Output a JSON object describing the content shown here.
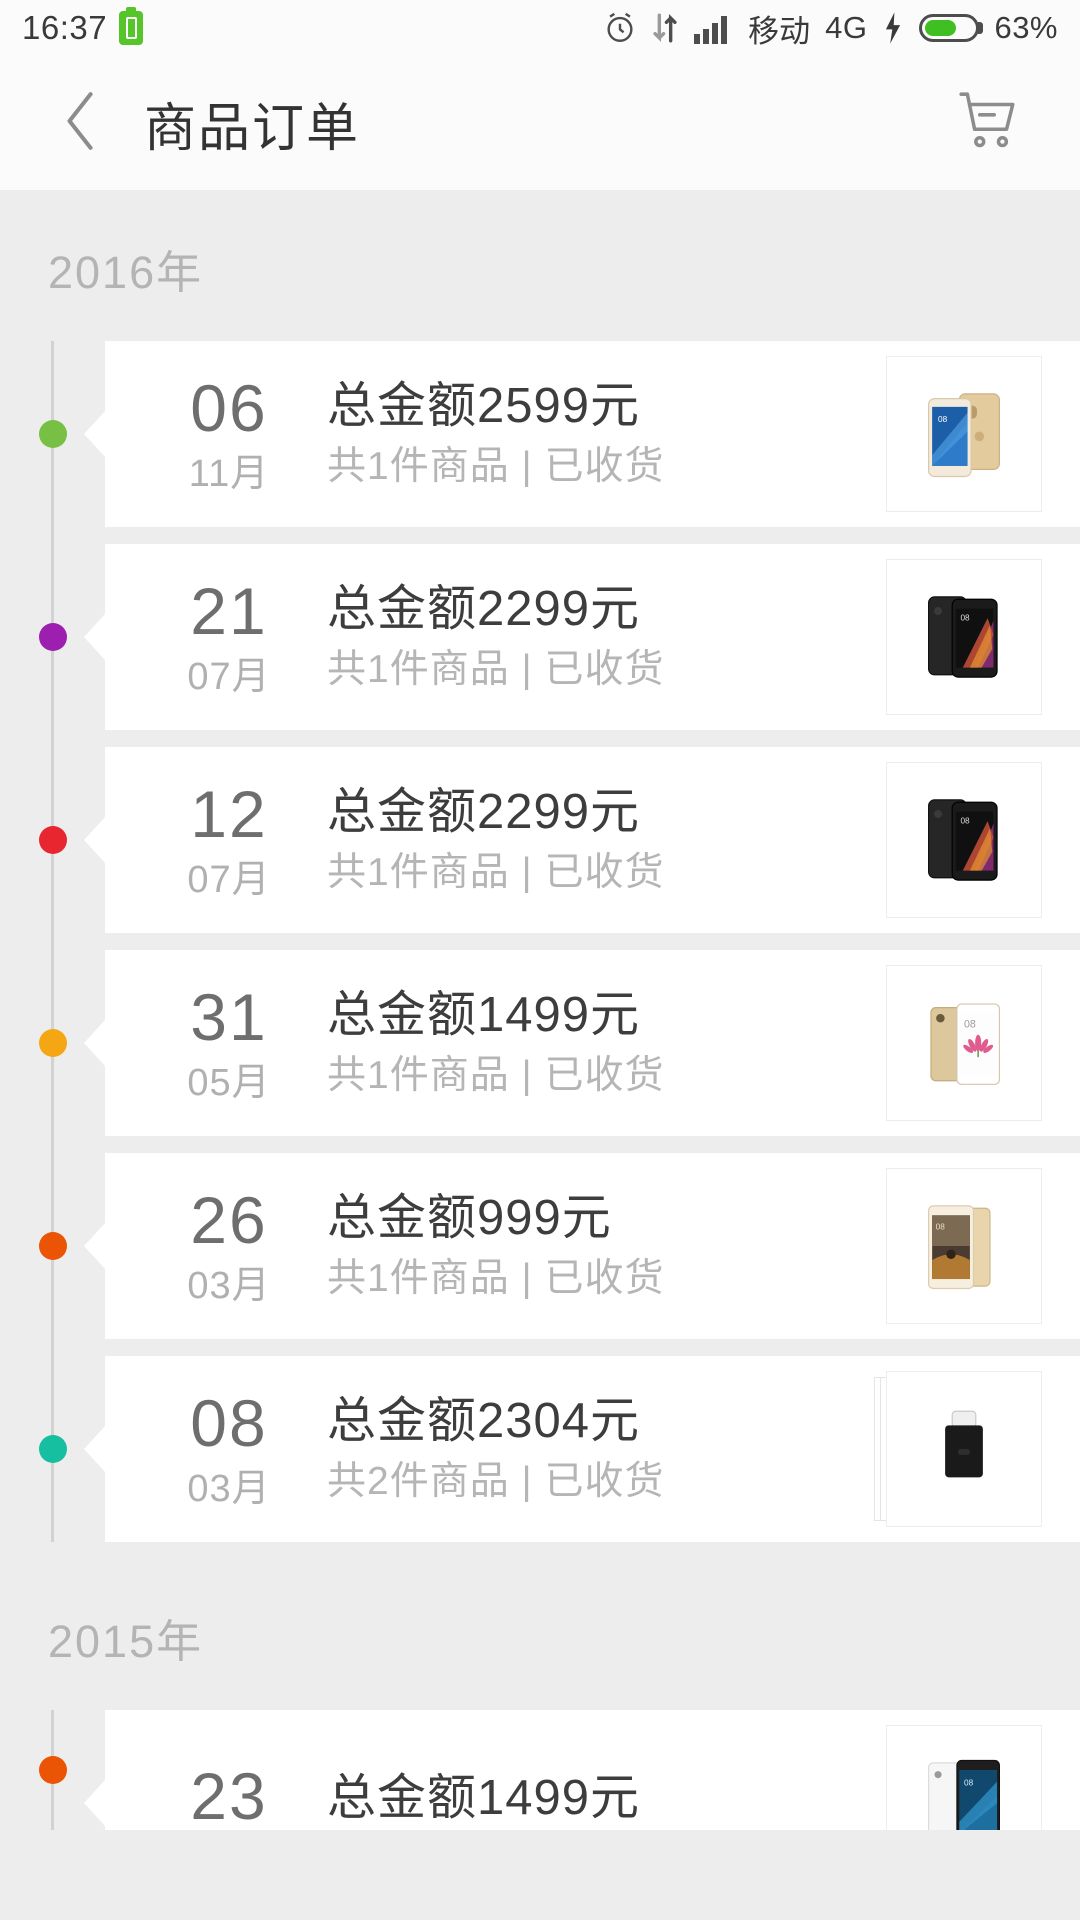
{
  "status_bar": {
    "time": "16:37",
    "battery_saver_icon": "green-battery-icon",
    "alarm_icon": "alarm-clock-icon",
    "data_icon": "data-transfer-icon",
    "signal_icon": "signal-bars-icon",
    "carrier": "移动",
    "network": "4G",
    "charging_icon": "charging-bolt-icon",
    "battery_percent": "63%",
    "battery_level": 63
  },
  "app_bar": {
    "back_icon": "back-chevron-icon",
    "title": "商品订单",
    "cart_icon": "shopping-cart-icon"
  },
  "groups": [
    {
      "year": "2016年",
      "orders": [
        {
          "day": "06",
          "month": "11月",
          "amount": "总金额2599元",
          "meta": "共1件商品 | 已收货",
          "dot_color": "#78c043",
          "thumb": "phone-gold-mi5s-icon",
          "stacked": false
        },
        {
          "day": "21",
          "month": "07月",
          "amount": "总金额2299元",
          "meta": "共1件商品 | 已收货",
          "dot_color": "#9c1fb0",
          "thumb": "phone-black-mi5-icon",
          "stacked": false
        },
        {
          "day": "12",
          "month": "07月",
          "amount": "总金额2299元",
          "meta": "共1件商品 | 已收货",
          "dot_color": "#e8262f",
          "thumb": "phone-black-mi5-icon",
          "stacked": false
        },
        {
          "day": "31",
          "month": "05月",
          "amount": "总金额1499元",
          "meta": "共1件商品 | 已收货",
          "dot_color": "#f5a613",
          "thumb": "phone-gold-mimax-icon",
          "stacked": false
        },
        {
          "day": "26",
          "month": "03月",
          "amount": "总金额999元",
          "meta": "共1件商品 | 已收货",
          "dot_color": "#ea5404",
          "thumb": "phone-gold-note3-icon",
          "stacked": false
        },
        {
          "day": "08",
          "month": "03月",
          "amount": "总金额2304元",
          "meta": "共2件商品 | 已收货",
          "dot_color": "#16bfa0",
          "thumb": "usb-c-adapter-icon",
          "stacked": true
        }
      ]
    },
    {
      "year": "2015年",
      "orders": [
        {
          "day": "23",
          "month": "",
          "amount": "总金额1499元",
          "meta": "",
          "dot_color": "#ea5404",
          "thumb": "phone-white-mi4c-icon",
          "stacked": false,
          "partial": true
        }
      ]
    }
  ]
}
